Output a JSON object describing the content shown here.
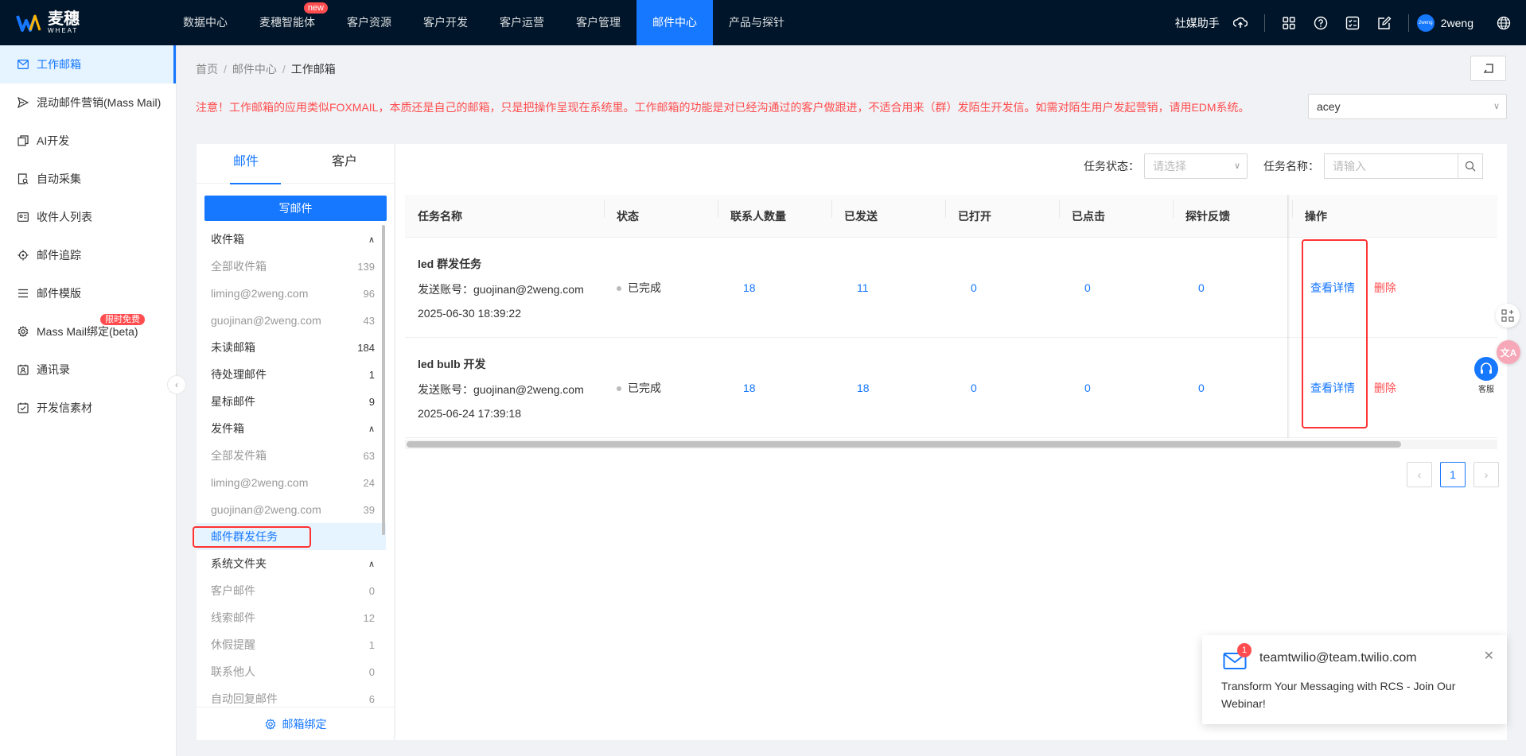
{
  "brand": {
    "name_cn": "麦穗",
    "name_en": "WHEAT"
  },
  "topnav": {
    "items": [
      "数据中心",
      "麦穗智能体",
      "客户资源",
      "客户开发",
      "客户运营",
      "客户管理",
      "邮件中心",
      "产品与探针"
    ],
    "active_index": 6,
    "new_badge": "new",
    "assistant_label": "社媒助手",
    "username": "2weng",
    "avatar_text": "2weng"
  },
  "sidebar": {
    "items": [
      "工作邮箱",
      "混动邮件营销(Mass Mail)",
      "AI开发",
      "自动采集",
      "收件人列表",
      "邮件追踪",
      "邮件模版",
      "Mass Mail绑定(beta)",
      "通讯录",
      "开发信素材"
    ],
    "limit_badge": "限时免费"
  },
  "breadcrumb": {
    "home": "首页",
    "section": "邮件中心",
    "current": "工作邮箱",
    "sep": "/"
  },
  "notice": "注意！工作邮箱的应用类似FOXMAIL，本质还是自己的邮箱，只是把操作呈现在系统里。工作邮箱的功能是对已经沟通过的客户做跟进，不适合用来（群）发陌生开发信。如需对陌生用户发起营销，请用EDM系统。",
  "account_select": {
    "value": "acey"
  },
  "mail_panel": {
    "tabs": [
      "邮件",
      "客户"
    ],
    "compose_label": "写邮件",
    "inbox_group": "收件箱",
    "inbox_items": [
      {
        "label": "全部收件箱",
        "count": "139"
      },
      {
        "label": "liming@2weng.com",
        "count": "96"
      },
      {
        "label": "guojinan@2weng.com",
        "count": "43"
      }
    ],
    "special_items": [
      {
        "label": "未读邮箱",
        "count": "184"
      },
      {
        "label": "待处理邮件",
        "count": "1"
      },
      {
        "label": "星标邮件",
        "count": "9"
      }
    ],
    "sent_group": "发件箱",
    "sent_items": [
      {
        "label": "全部发件箱",
        "count": "63"
      },
      {
        "label": "liming@2weng.com",
        "count": "24"
      },
      {
        "label": "guojinan@2weng.com",
        "count": "39"
      }
    ],
    "mass_task_label": "邮件群发任务",
    "system_group": "系统文件夹",
    "system_items": [
      {
        "label": "客户邮件",
        "count": "0"
      },
      {
        "label": "线索邮件",
        "count": "12"
      },
      {
        "label": "休假提醒",
        "count": "1"
      },
      {
        "label": "联系他人",
        "count": "0"
      },
      {
        "label": "自动回复邮件",
        "count": "6"
      }
    ],
    "footer_label": "邮箱绑定"
  },
  "filters": {
    "status_label": "任务状态：",
    "status_placeholder": "请选择",
    "name_label": "任务名称：",
    "name_placeholder": "请输入"
  },
  "table": {
    "headers": [
      "任务名称",
      "状态",
      "联系人数量",
      "已发送",
      "已打开",
      "已点击",
      "探针反馈",
      "操作"
    ],
    "rows": [
      {
        "name": "led 群发任务",
        "account": "发送账号：guojinan@2weng.com",
        "time": "2025-06-30 18:39:22",
        "status": "已完成",
        "contacts": "18",
        "sent": "11",
        "opened": "0",
        "clicked": "0",
        "probe": "0",
        "view": "查看详情",
        "delete": "删除"
      },
      {
        "name": "led bulb 开发",
        "account": "发送账号：guojinan@2weng.com",
        "time": "2025-06-24 17:39:18",
        "status": "已完成",
        "contacts": "18",
        "sent": "18",
        "opened": "0",
        "clicked": "0",
        "probe": "0",
        "view": "查看详情",
        "delete": "删除"
      }
    ]
  },
  "pagination": {
    "current": "1"
  },
  "kefu_label": "客服",
  "toast": {
    "badge": "1",
    "sender": "teamtwilio@team.twilio.com",
    "subject": "Transform Your Messaging with RCS - Join Our Webinar!"
  },
  "colors": {
    "primary": "#1677ff",
    "danger": "#ff4d4f",
    "nav_bg": "#001529"
  }
}
